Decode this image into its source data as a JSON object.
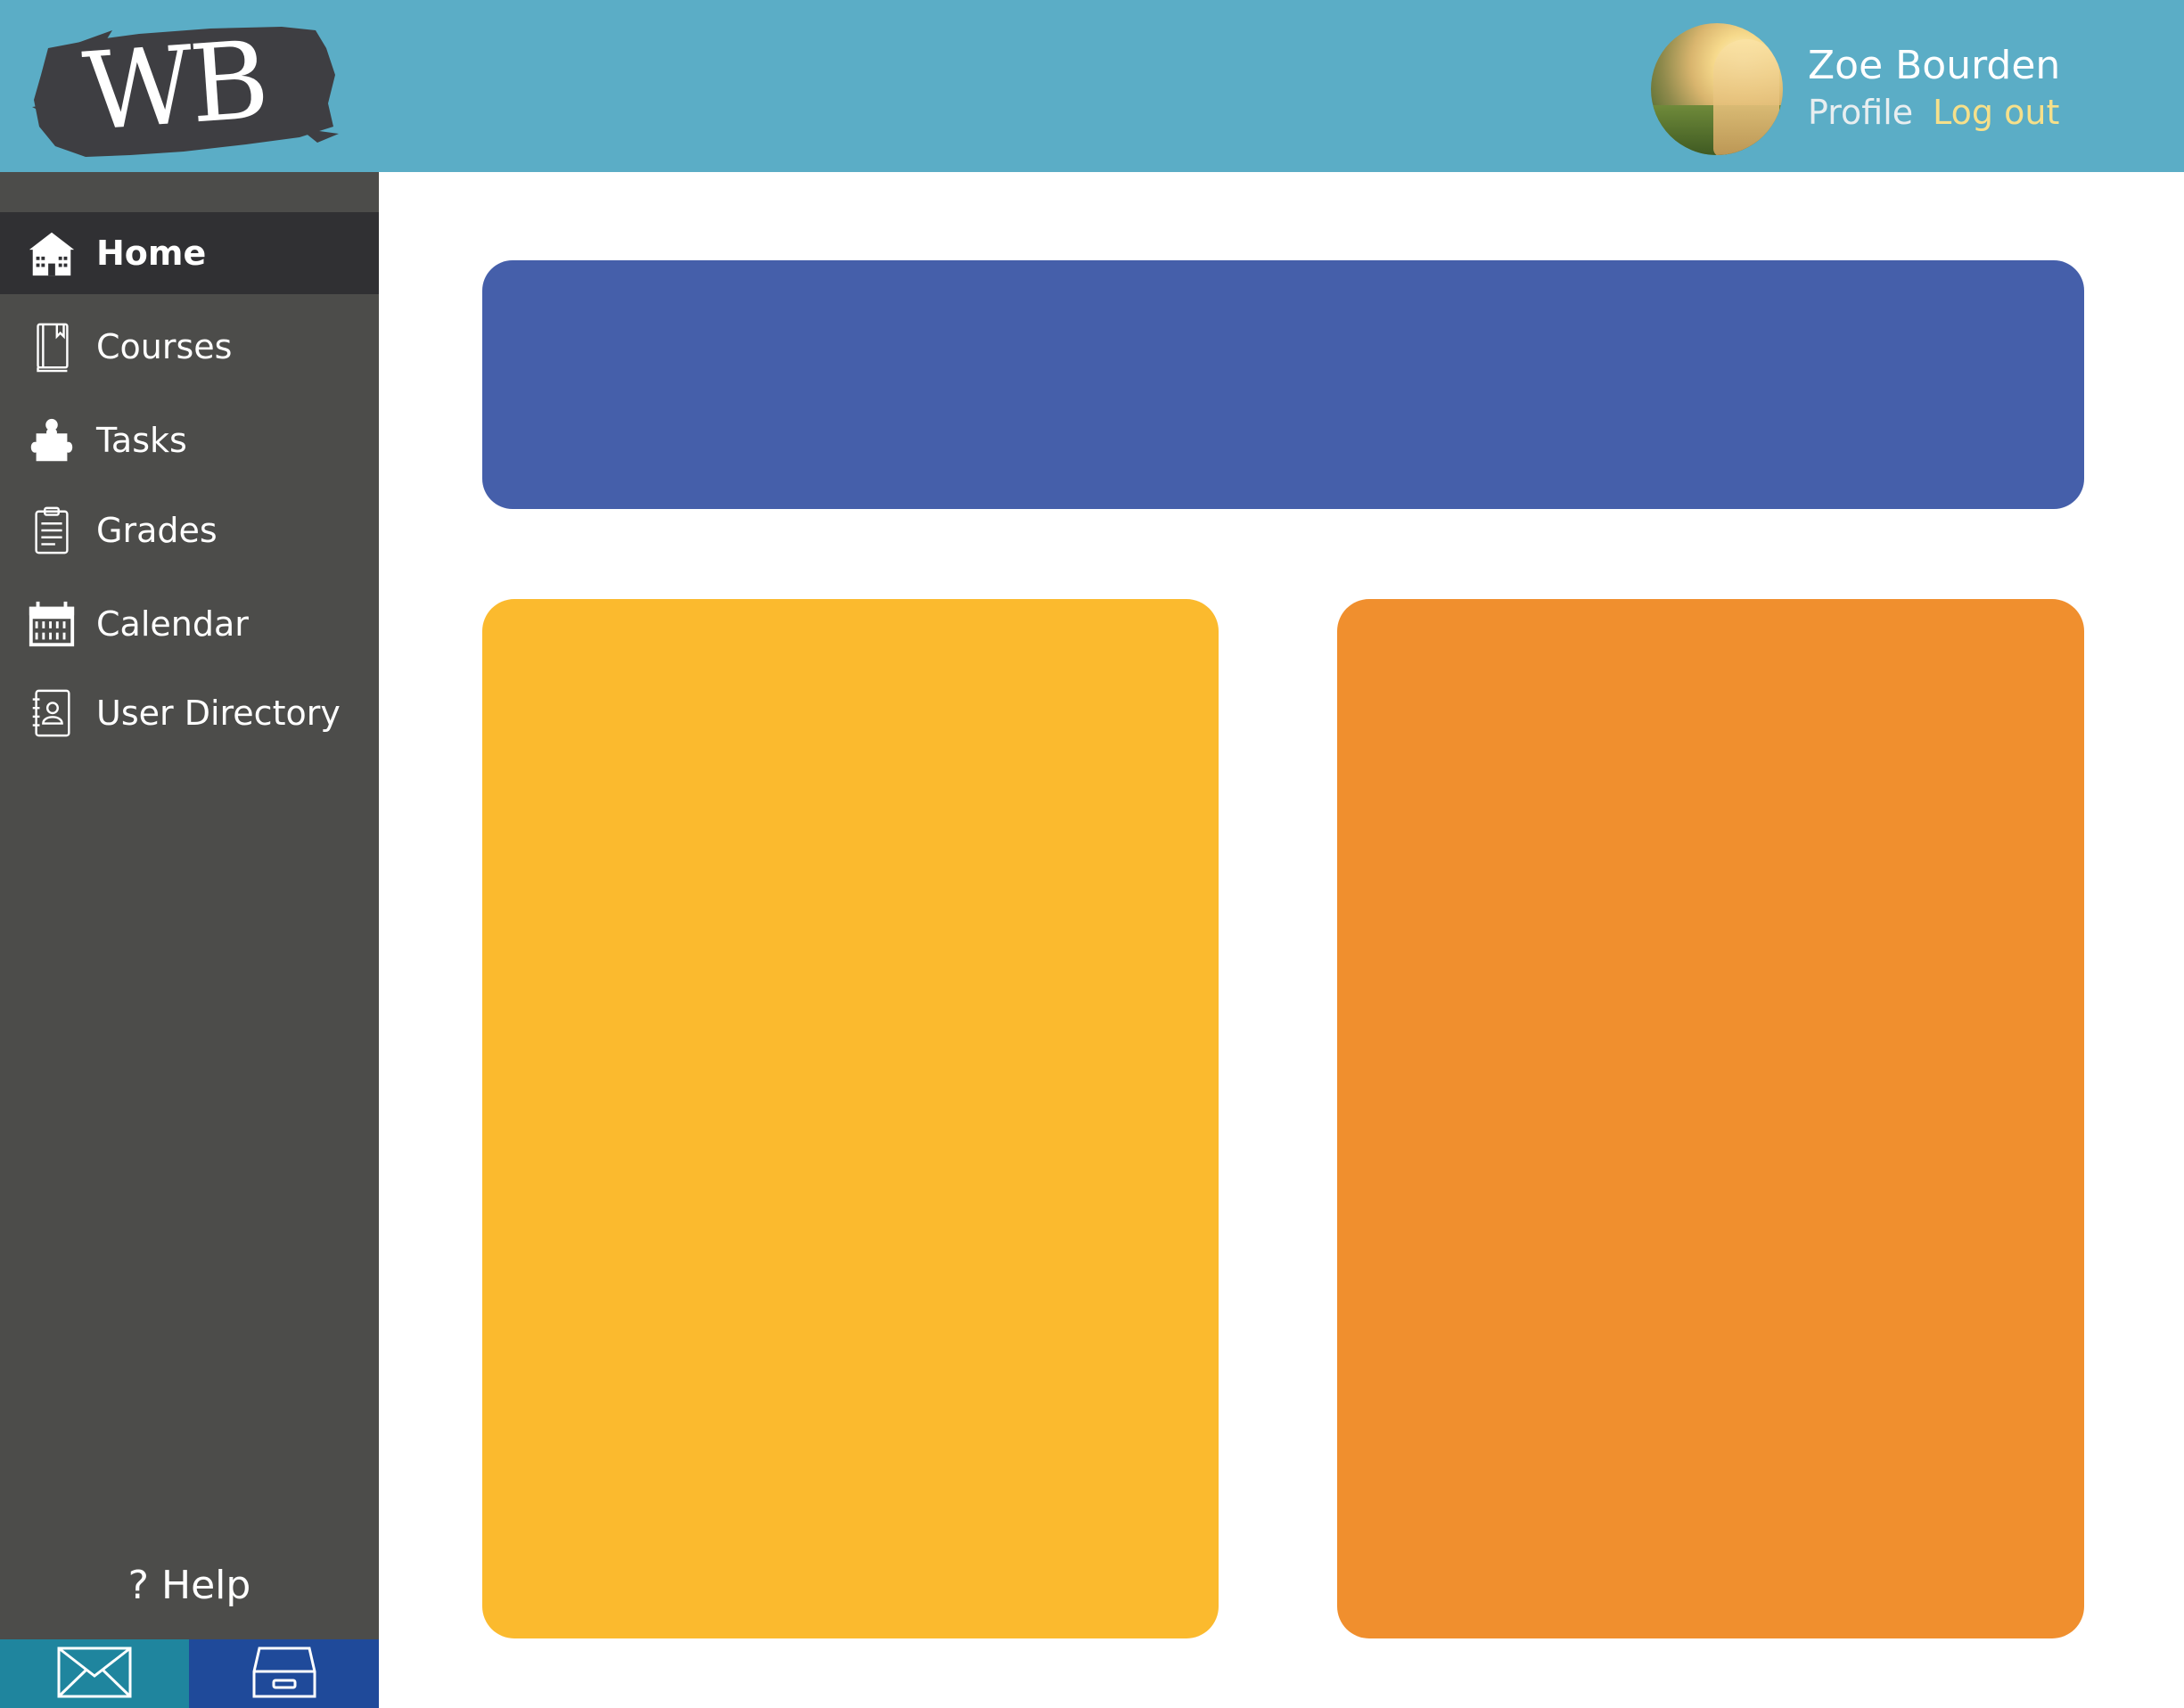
{
  "header": {
    "logo_text": "WB",
    "user": {
      "name": "Zoe Bourden",
      "profile_label": "Profile",
      "logout_label": "Log out"
    }
  },
  "sidebar": {
    "items": [
      {
        "label": "Home",
        "icon": "home-icon",
        "active": true
      },
      {
        "label": "Courses",
        "icon": "book-icon",
        "active": false
      },
      {
        "label": "Tasks",
        "icon": "puzzle-icon",
        "active": false
      },
      {
        "label": "Grades",
        "icon": "clipboard-icon",
        "active": false
      },
      {
        "label": "Calendar",
        "icon": "calendar-icon",
        "active": false
      },
      {
        "label": "User Directory",
        "icon": "address-book-icon",
        "active": false
      }
    ],
    "help_label": "? Help",
    "bottom_buttons": [
      {
        "icon": "mail-icon"
      },
      {
        "icon": "inbox-tray-icon"
      }
    ]
  },
  "colors": {
    "header": "#5BADC6",
    "sidebar": "#4C4C4A",
    "sidebar_active": "#303033",
    "card_blue": "#455FAA",
    "card_yellow": "#FBBA2E",
    "card_orange": "#F08F2E",
    "mail_button": "#1F859E",
    "inbox_button": "#1F4A9A"
  }
}
